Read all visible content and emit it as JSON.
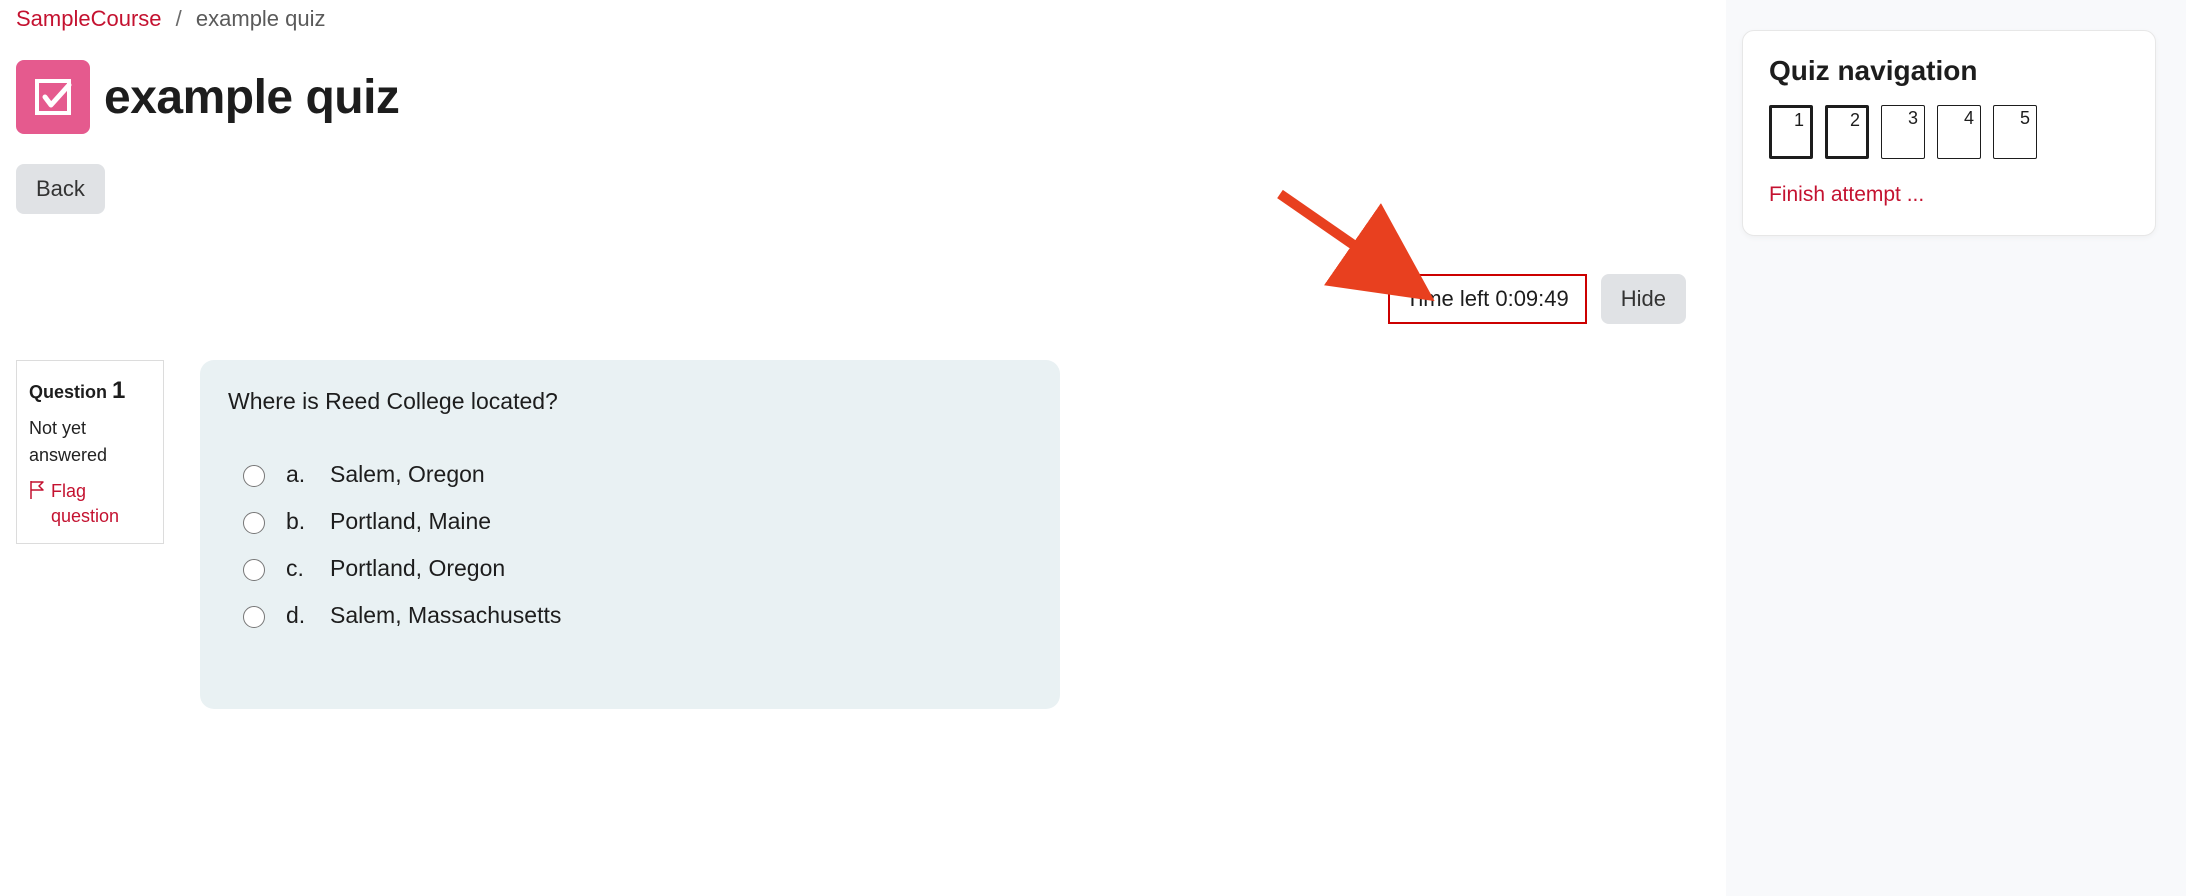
{
  "breadcrumb": {
    "course": "SampleCourse",
    "sep": "/",
    "current": "example quiz"
  },
  "title": "example quiz",
  "back_label": "Back",
  "timer": {
    "label": "Time left 0:09:49",
    "hide_label": "Hide"
  },
  "question_info": {
    "word": "Question",
    "number": "1",
    "status": "Not yet answered",
    "flag_label": "Flag question"
  },
  "question": {
    "text": "Where is Reed College located?",
    "options": [
      {
        "letter": "a.",
        "text": "Salem, Oregon"
      },
      {
        "letter": "b.",
        "text": "Portland, Maine"
      },
      {
        "letter": "c.",
        "text": "Portland, Oregon"
      },
      {
        "letter": "d.",
        "text": "Salem, Massachusetts"
      }
    ]
  },
  "nav": {
    "title": "Quiz navigation",
    "items": [
      "1",
      "2",
      "3",
      "4",
      "5"
    ],
    "finish_label": "Finish attempt ..."
  }
}
